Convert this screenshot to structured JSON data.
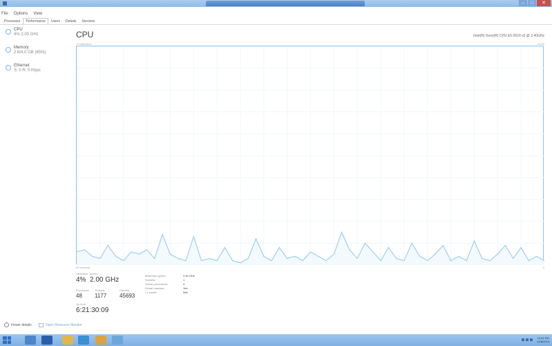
{
  "menu": [
    "File",
    "Options",
    "View"
  ],
  "tabs": [
    {
      "label": "Processes",
      "active": false
    },
    {
      "label": "Performance",
      "active": true
    },
    {
      "label": "Users",
      "active": false
    },
    {
      "label": "Details",
      "active": false
    },
    {
      "label": "Services",
      "active": false
    }
  ],
  "sidebar": [
    {
      "name": "CPU",
      "sub": "4% 2.00 GHz",
      "selected": true
    },
    {
      "name": "Memory",
      "sub": "2.6/4.0 GB (65%)",
      "selected": false
    },
    {
      "name": "Ethernet",
      "sub": "S: 0 R: 0 Kbps",
      "selected": false
    }
  ],
  "main": {
    "title": "CPU",
    "cpu_model": "Intel(R) Xeon(R) CPU E5-2620 v3 @ 2.40GHz",
    "graph_label_top_left": "% Utilization",
    "graph_label_top_right": "100%",
    "graph_label_bottom_left": "60 seconds",
    "graph_label_bottom_right": "0"
  },
  "stats": {
    "utilization_label": "Utilization",
    "utilization_value": "4%",
    "speed_label": "Speed",
    "speed_value": "2.00 GHz",
    "processes_label": "Processes",
    "processes_value": "48",
    "threads_label": "Threads",
    "threads_value": "1177",
    "handles_label": "Handles",
    "handles_value": "45693",
    "uptime_label": "Up time",
    "uptime_value": "6:21:30:09"
  },
  "details": [
    {
      "label": "Maximum speed:",
      "value": "2.40 GHz"
    },
    {
      "label": "Sockets:",
      "value": "1"
    },
    {
      "label": "Virtual processors:",
      "value": "4"
    },
    {
      "label": "Virtual machine:",
      "value": "Yes"
    },
    {
      "label": "L1 cache:",
      "value": "N/A"
    }
  ],
  "footer": {
    "fewer_details": "Fewer details",
    "open_monitor": "Open Resource Monitor"
  },
  "taskbar": {
    "icons": [
      {
        "name": "start-icon",
        "color": "#2f6fc0"
      },
      {
        "name": "server-manager-icon",
        "color": "#4a86c8"
      },
      {
        "name": "powershell-icon",
        "color": "#2a5fa8"
      },
      {
        "name": "file-explorer-icon",
        "color": "#e3b64a"
      },
      {
        "name": "internet-explorer-icon",
        "color": "#3b8fd6"
      },
      {
        "name": "app-icon",
        "color": "#d9a441"
      },
      {
        "name": "task-manager-icon",
        "color": "#6fa6d9"
      }
    ],
    "time": "10:41 PM",
    "date": "12/8/2014"
  },
  "chart_data": {
    "type": "line",
    "title": "CPU",
    "ylim": [
      0,
      100
    ],
    "xlim": [
      60,
      0
    ],
    "series": [
      {
        "name": "",
        "values": [
          6,
          7,
          4,
          3,
          9,
          4,
          2,
          6,
          5,
          7,
          3,
          14,
          5,
          3,
          2,
          13,
          2,
          3,
          2,
          8,
          2,
          1,
          3,
          12,
          4,
          2,
          8,
          3,
          4,
          2,
          6,
          4,
          2,
          5,
          15,
          7,
          3,
          10,
          6,
          2,
          8,
          3,
          2,
          10,
          4,
          2,
          5,
          9,
          2,
          4,
          2,
          11,
          3,
          2,
          5,
          9,
          3,
          8,
          2,
          4,
          2
        ]
      }
    ]
  }
}
